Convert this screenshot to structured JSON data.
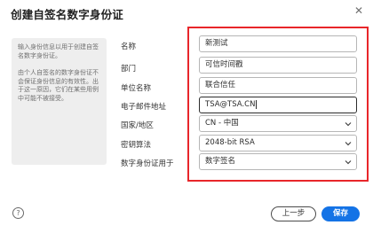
{
  "dialog": {
    "title": "创建自签名数字身份证",
    "info": [
      "输入身份信息以用于创建自签名数字身份证。",
      "由个人自签名的数字身份证不会保证身份信息的有效性。出于这一原因，它们在某些用例中可能不被接受。"
    ],
    "fields": {
      "name": {
        "label": "名称",
        "value": "新测试"
      },
      "department": {
        "label": "部门",
        "value": "可信时间戳"
      },
      "organization": {
        "label": "单位名称",
        "value": "联合信任"
      },
      "email": {
        "label": "电子邮件地址",
        "value": "TSA@TSA.CN"
      },
      "country": {
        "label": "国家/地区",
        "value": "CN - 中国"
      },
      "key_algorithm": {
        "label": "密钥算法",
        "value": "2048-bit RSA"
      },
      "usage": {
        "label": "数字身份证用于",
        "value": "数字签名"
      }
    },
    "buttons": {
      "help": "?",
      "previous": "上一步",
      "save": "保存"
    },
    "colors": {
      "accent": "#1473e6",
      "highlight": "#e8262a"
    }
  }
}
